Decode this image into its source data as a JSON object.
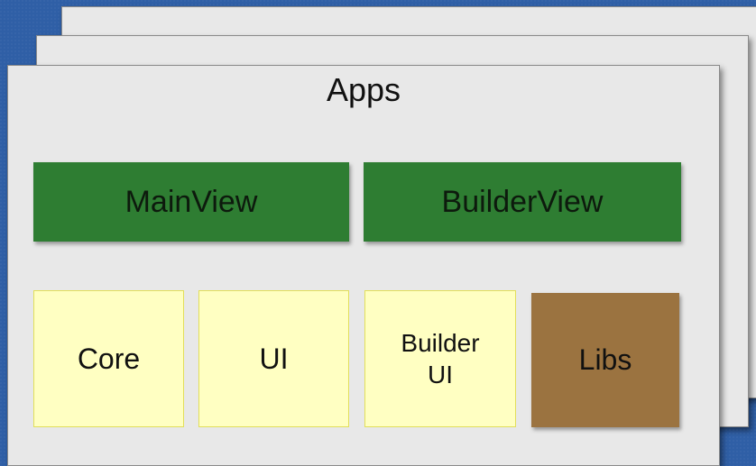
{
  "diagram": {
    "title": "Apps",
    "views": [
      {
        "label": "MainView"
      },
      {
        "label": "BuilderView"
      }
    ],
    "modules": [
      {
        "label": "Core"
      },
      {
        "label": "UI"
      },
      {
        "label_line1": "Builder",
        "label_line2": "UI"
      },
      {
        "label": "Libs"
      }
    ]
  },
  "colors": {
    "background": "#2f5fa6",
    "sheet": "#e8e8e8",
    "view_box": "#2e7d32",
    "module_box": "#ffffc2",
    "libs_box": "#9b7340"
  }
}
